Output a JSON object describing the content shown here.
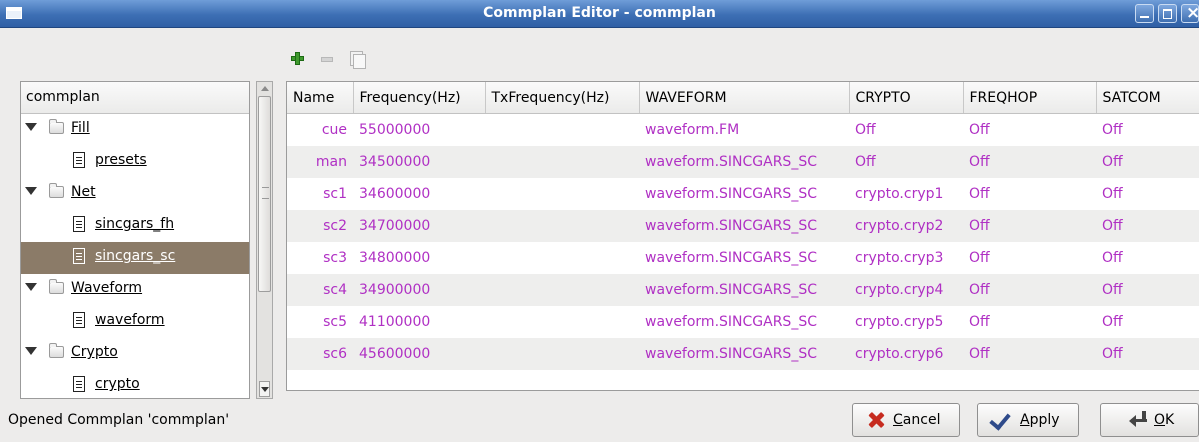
{
  "window": {
    "title": "Commplan Editor - commplan"
  },
  "toolbar": {
    "add_label": "",
    "remove_label": "",
    "copy_label": ""
  },
  "tree": {
    "header": "commplan",
    "nodes": [
      {
        "label": "Fill",
        "kind": "folder",
        "level": 0,
        "expanded": true
      },
      {
        "label": "presets",
        "kind": "document",
        "level": 1
      },
      {
        "label": "Net",
        "kind": "folder",
        "level": 0,
        "expanded": true
      },
      {
        "label": "sincgars_fh",
        "kind": "document",
        "level": 1
      },
      {
        "label": "sincgars_sc",
        "kind": "document",
        "level": 1,
        "selected": true
      },
      {
        "label": "Waveform",
        "kind": "folder",
        "level": 0,
        "expanded": true
      },
      {
        "label": "waveform",
        "kind": "document",
        "level": 1
      },
      {
        "label": "Crypto",
        "kind": "folder",
        "level": 0,
        "expanded": true
      },
      {
        "label": "crypto",
        "kind": "document",
        "level": 1
      }
    ]
  },
  "table": {
    "columns": [
      "Name",
      "Frequency(Hz)",
      "TxFrequency(Hz)",
      "WAVEFORM",
      "CRYPTO",
      "FREQHOP",
      "SATCOM"
    ],
    "rows": [
      [
        "cue",
        "55000000",
        "",
        "waveform.FM",
        "Off",
        "Off",
        "Off"
      ],
      [
        "man",
        "34500000",
        "",
        "waveform.SINCGARS_SC",
        "Off",
        "Off",
        "Off"
      ],
      [
        "sc1",
        "34600000",
        "",
        "waveform.SINCGARS_SC",
        "crypto.cryp1",
        "Off",
        "Off"
      ],
      [
        "sc2",
        "34700000",
        "",
        "waveform.SINCGARS_SC",
        "crypto.cryp2",
        "Off",
        "Off"
      ],
      [
        "sc3",
        "34800000",
        "",
        "waveform.SINCGARS_SC",
        "crypto.cryp3",
        "Off",
        "Off"
      ],
      [
        "sc4",
        "34900000",
        "",
        "waveform.SINCGARS_SC",
        "crypto.cryp4",
        "Off",
        "Off"
      ],
      [
        "sc5",
        "41100000",
        "",
        "waveform.SINCGARS_SC",
        "crypto.cryp5",
        "Off",
        "Off"
      ],
      [
        "sc6",
        "45600000",
        "",
        "waveform.SINCGARS_SC",
        "crypto.cryp6",
        "Off",
        "Off"
      ]
    ]
  },
  "status": {
    "text": "Opened Commplan 'commplan'"
  },
  "buttons": {
    "cancel": "Cancel",
    "apply": "Apply",
    "ok": "OK"
  },
  "colors": {
    "title_bar": "#3d6fb4",
    "selection": "#8b7b68",
    "cell_text": "#b030c4",
    "alt_row": "#eeeeed"
  }
}
